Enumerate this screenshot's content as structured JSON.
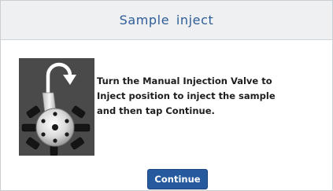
{
  "dialog": {
    "title": "Sample inject",
    "message": "Turn the Manual Injection Valve to\nInject position to inject the sample\nand then tap Continue.",
    "illustration_icon": "injection-valve-rotate-icon",
    "continue_label": "Continue"
  },
  "colors": {
    "header_bg": "#eef0f2",
    "title_text": "#2e5c98",
    "button_bg": "#265a9e",
    "button_text": "#ffffff",
    "illustration_bg": "#4a4a4a"
  }
}
